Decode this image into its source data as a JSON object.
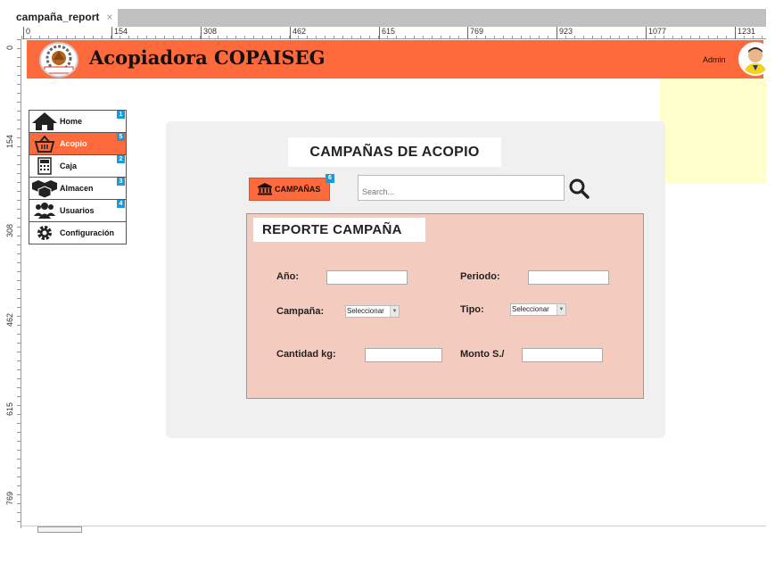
{
  "tab": {
    "title": "campaña_report",
    "close": "×"
  },
  "ruler": {
    "top": [
      "0",
      "154",
      "308",
      "462",
      "615",
      "769",
      "923",
      "1077",
      "1231"
    ],
    "left": [
      "0",
      "154",
      "308",
      "462",
      "615",
      "769"
    ]
  },
  "header": {
    "title": "Acopiadora COPAISEG",
    "user": "Admin",
    "logo_text": "COPAISEG",
    "bg_color": "#ff6a3d"
  },
  "sidebar": {
    "items": [
      {
        "label": "Home",
        "badge": "1",
        "icon": "home-icon"
      },
      {
        "label": "Acopio",
        "badge": "5",
        "icon": "basket-icon"
      },
      {
        "label": "Caja",
        "badge": "2",
        "icon": "calculator-icon"
      },
      {
        "label": "Almacen",
        "badge": "3",
        "icon": "boxes-icon"
      },
      {
        "label": "Usuarios",
        "badge": "4",
        "icon": "users-icon"
      },
      {
        "label": "Configuración",
        "badge": "",
        "icon": "gear-icon"
      }
    ]
  },
  "main": {
    "title": "CAMPAÑAS DE ACOPIO",
    "campaigns_button": {
      "label": "CAMPAÑAS",
      "badge": "6",
      "icon": "bank-icon"
    },
    "search": {
      "placeholder": "Search..."
    },
    "report": {
      "title": "REPORTE CAMPAÑA",
      "year_label": "Año:",
      "period_label": "Periodo:",
      "campaign_label": "Campaña:",
      "campaign_select": "Seleccionar",
      "type_label": "Tipo:",
      "type_select": "Seleccionar",
      "quantity_label": "Cantidad kg:",
      "amount_label": "Monto S./"
    }
  },
  "colors": {
    "accent": "#ff6a3d",
    "badge": "#1a9bd8",
    "report_bg": "#f4cbbf",
    "note": "#ffffcc"
  }
}
